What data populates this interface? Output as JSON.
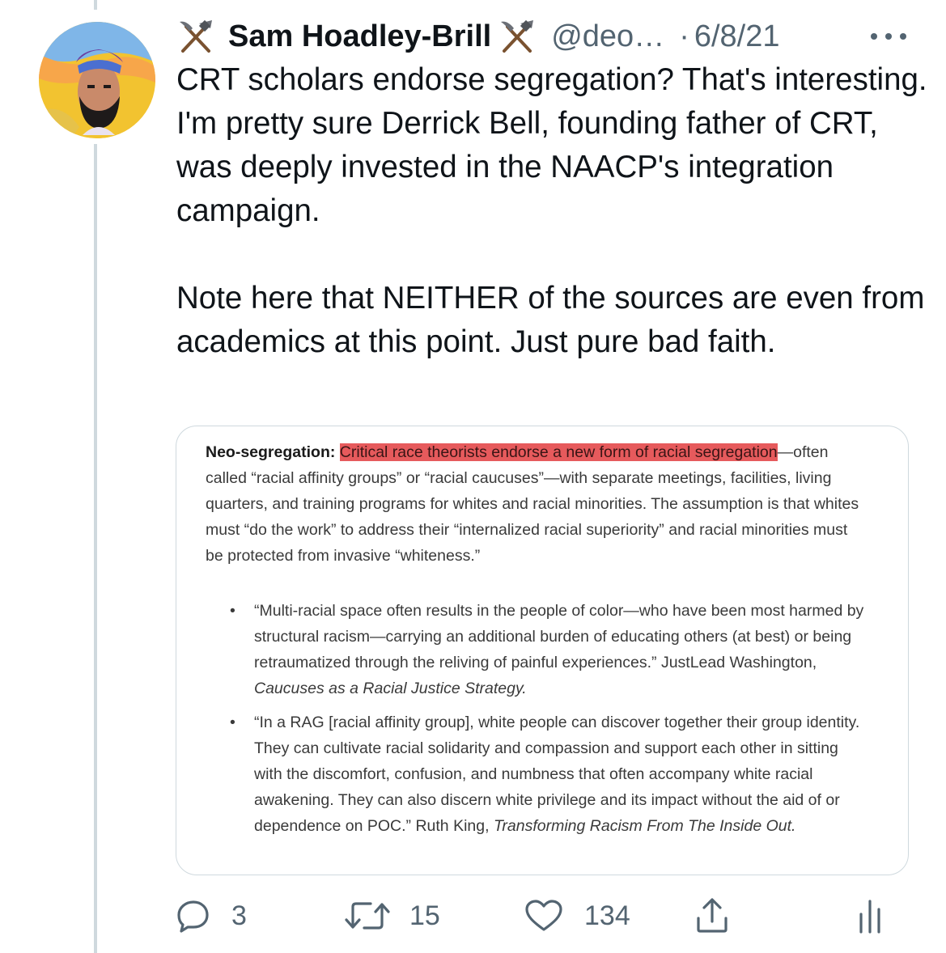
{
  "tweet": {
    "author_name": "Sam Hoadley-Brill",
    "author_handle": "@deo…",
    "separator": "·",
    "date": "6/8/21",
    "name_icon": "hammer-and-pick-icon",
    "text": "CRT scholars endorse segregation? That's interesting. I'm pretty sure Derrick Bell, founding father of CRT, was deeply invested in the NAACP's integration campaign.\n\nNote here that NEITHER of the sources are even from academics at this point. Just pure bad faith."
  },
  "image_card": {
    "intro_title": "Neo-segregation:",
    "highlighted": "Critical race theorists endorse a new form of racial segregation",
    "intro_rest": "—often called “racial affinity groups” or “racial caucuses”—with separate meetings, facilities, living quarters, and training programs for whites and racial minorities. The assumption is that whites must “do the work” to address their “internalized racial superiority” and racial minorities must be protected from invasive “whiteness.”",
    "quotes": [
      {
        "bullet": "•",
        "text": "“Multi-racial space often results in the people of color—who have been most harmed by structural racism—carrying an additional burden of educating others (at best) or being retraumatized through the reliving of painful experiences.” JustLead Washington, ",
        "source": "Caucuses as a Racial Justice Strategy."
      },
      {
        "bullet": "•",
        "text": "“In a RAG [racial affinity group], white people can discover together their group identity. They can cultivate racial solidarity and compassion and support each other in sitting with the discomfort, confusion, and numbness that often accompany white racial awakening. They can also discern white privilege and its impact without the aid of or dependence on POC.” Ruth King, ",
        "source": "Transforming Racism From The Inside Out."
      }
    ],
    "highlight_color": "#e65a5c"
  },
  "actions": {
    "reply_count": "3",
    "retweet_count": "15",
    "like_count": "134",
    "icons": [
      "reply-icon",
      "retweet-icon",
      "like-icon",
      "share-icon",
      "analytics-icon"
    ]
  },
  "colors": {
    "text": "#0f1419",
    "secondary": "#536471",
    "border": "#cfd9de"
  }
}
